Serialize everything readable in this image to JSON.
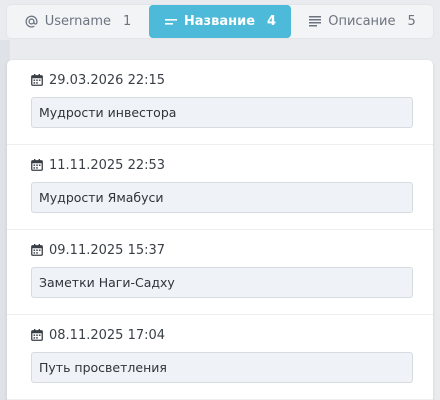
{
  "tabs": [
    {
      "icon": "at-icon",
      "label": "Username",
      "count": "1",
      "active": false
    },
    {
      "icon": "title-icon",
      "label": "Название",
      "count": "4",
      "active": true
    },
    {
      "icon": "description-icon",
      "label": "Описание",
      "count": "5",
      "active": false
    }
  ],
  "entries": [
    {
      "date": "29.03.2026 22:15",
      "value": "Мудрости инвестора"
    },
    {
      "date": "11.11.2025 22:53",
      "value": "Мудрости Ямабуси"
    },
    {
      "date": "09.11.2025 15:37",
      "value": "Заметки Наги-Садху"
    },
    {
      "date": "08.11.2025 17:04",
      "value": "Путь просветления"
    }
  ],
  "colors": {
    "accent": "#4dbad9",
    "background": "#e9ebee",
    "field_bg": "#eff2f6"
  }
}
